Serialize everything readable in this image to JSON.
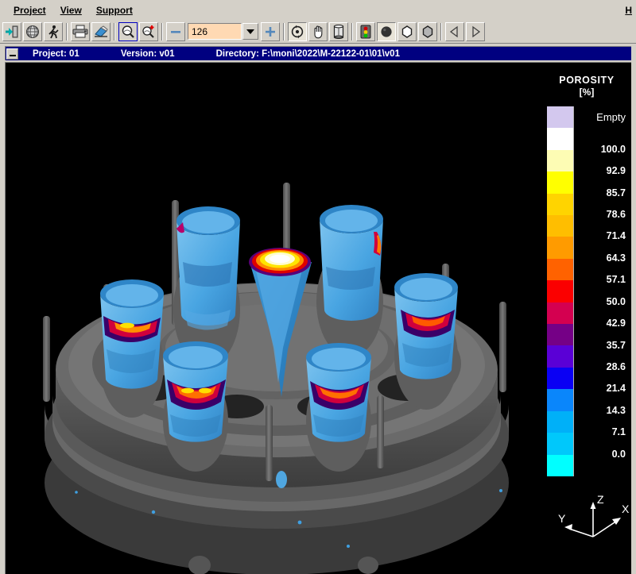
{
  "menu": {
    "items": [
      {
        "label": "Project",
        "accel": "P"
      },
      {
        "label": "View",
        "accel": "V"
      },
      {
        "label": "Support",
        "accel": "S"
      }
    ],
    "right_item": {
      "label": "H",
      "accel": "H"
    }
  },
  "toolbar": {
    "buttons": [
      {
        "name": "exit-icon",
        "title": "Exit"
      },
      {
        "name": "mesh-globe-icon",
        "title": "Mesh"
      },
      {
        "name": "runner-icon",
        "title": "Run"
      },
      {
        "name": "printer-icon",
        "title": "Print"
      },
      {
        "name": "eraser-icon",
        "title": "Erase"
      },
      {
        "name": "zoom-icon",
        "title": "Zoom",
        "state": "active"
      },
      {
        "name": "zoom-in-icon",
        "title": "Zoom In"
      },
      {
        "name": "minus-icon",
        "title": "Decrease"
      },
      {
        "name": "plus-icon",
        "title": "Increase"
      },
      {
        "name": "rotate-icon",
        "title": "Rotate",
        "state": "pressed"
      },
      {
        "name": "pan-hand-icon",
        "title": "Pan"
      },
      {
        "name": "box-icon",
        "title": "Bounding Box"
      },
      {
        "name": "traffic-light-icon",
        "title": "Status"
      },
      {
        "name": "solid-sphere-icon",
        "title": "Solid",
        "state": "pressed"
      },
      {
        "name": "white-hexagon-icon",
        "title": "Wireframe"
      },
      {
        "name": "gray-hexagon-icon",
        "title": "Shaded"
      },
      {
        "name": "prev-icon",
        "title": "Previous"
      },
      {
        "name": "next-icon",
        "title": "Next"
      }
    ],
    "value_field": {
      "value": "126",
      "placeholder": "126"
    }
  },
  "project_bar": {
    "project_label": "Project: 01",
    "version_label": "Version: v01",
    "directory_label": "Directory: F:\\moni\\2022\\M-22122-01\\01\\v01"
  },
  "legend": {
    "title": "POROSITY",
    "unit": "[%]",
    "empty_label": "Empty",
    "empty_color": "#d3c8ee",
    "bands": [
      {
        "color": "#d3c8ee",
        "label": "Empty"
      },
      {
        "color": "#ffffff",
        "label": "100.0"
      },
      {
        "color": "#fdfcb4",
        "label": "92.9"
      },
      {
        "color": "#ffff00",
        "label": "85.7"
      },
      {
        "color": "#ffd400",
        "label": "78.6"
      },
      {
        "color": "#ffbe00",
        "label": "71.4"
      },
      {
        "color": "#ff9b00",
        "label": "64.3"
      },
      {
        "color": "#ff6200",
        "label": "57.1"
      },
      {
        "color": "#fb0000",
        "label": "50.0"
      },
      {
        "color": "#d40050",
        "label": "42.9"
      },
      {
        "color": "#750086",
        "label": "35.7"
      },
      {
        "color": "#5a00d6",
        "label": "28.6"
      },
      {
        "color": "#0a00f4",
        "label": "21.4"
      },
      {
        "color": "#0a86fb",
        "label": "14.3"
      },
      {
        "color": "#00b0f8",
        "label": "7.1"
      },
      {
        "color": "#00c8fb",
        "label": "0.0"
      },
      {
        "color": "#00ffff",
        "label": ""
      }
    ]
  },
  "axis_triad": {
    "x_label": "X",
    "y_label": "Y",
    "z_label": "Z"
  },
  "scene": {
    "background": "#000000",
    "mold_color": "#6b6b6b",
    "casting_color": "#3f9fe0",
    "hotspot_colors": [
      "#ffff88",
      "#ff9b00",
      "#fb0000",
      "#750086"
    ],
    "casting_count": 7
  }
}
